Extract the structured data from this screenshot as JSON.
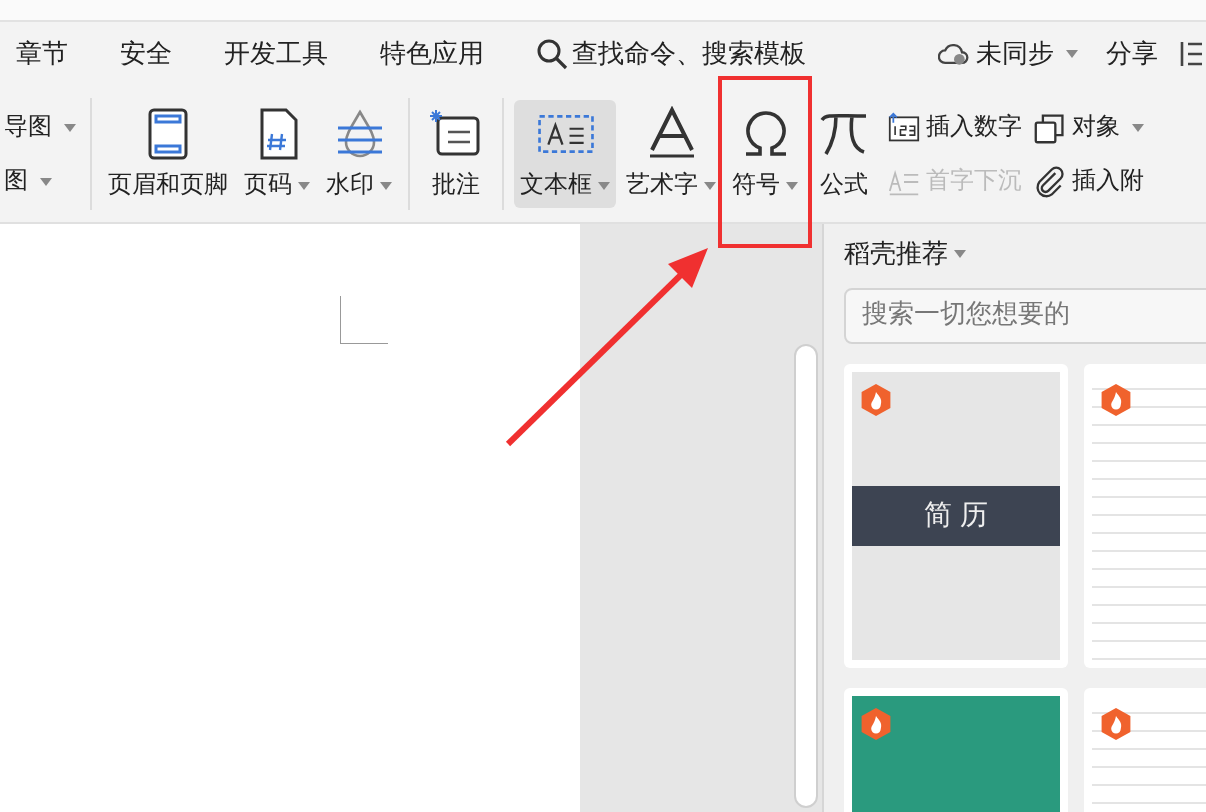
{
  "menu_tabs": [
    {
      "label": "章节"
    },
    {
      "label": "安全"
    },
    {
      "label": "开发工具"
    },
    {
      "label": "特色应用"
    }
  ],
  "search": {
    "placeholder": "查找命令、搜索模板"
  },
  "sync": {
    "label": "未同步",
    "dropdown": true
  },
  "share": {
    "label": "分享"
  },
  "ribbon_groups": [
    {
      "items": [
        {
          "kind": "small",
          "label": "导图",
          "dropdown": true,
          "selected": false,
          "disabled": false
        },
        {
          "kind": "small",
          "label": "图",
          "dropdown": true,
          "selected": false,
          "disabled": false
        }
      ]
    },
    {
      "items": [
        {
          "kind": "large",
          "label": "页眉和页脚",
          "dropdown": false,
          "selected": false,
          "disabled": false
        },
        {
          "kind": "large",
          "label": "页码",
          "dropdown": true,
          "selected": false,
          "disabled": false
        },
        {
          "kind": "large",
          "label": "水印",
          "dropdown": true,
          "selected": false,
          "disabled": false
        }
      ]
    },
    {
      "items": [
        {
          "kind": "large",
          "label": "批注",
          "dropdown": false,
          "selected": false,
          "disabled": false
        }
      ]
    },
    {
      "items": [
        {
          "kind": "large",
          "label": "文本框",
          "dropdown": true,
          "selected": true,
          "disabled": false
        },
        {
          "kind": "large",
          "label": "艺术字",
          "dropdown": true,
          "selected": false,
          "disabled": false
        },
        {
          "kind": "large",
          "label": "符号",
          "dropdown": true,
          "selected": false,
          "disabled": false
        },
        {
          "kind": "large",
          "label": "公式",
          "dropdown": false,
          "selected": false,
          "disabled": false
        },
        {
          "kind": "small",
          "label": "插入数字",
          "dropdown": false,
          "selected": false,
          "disabled": false
        },
        {
          "kind": "small",
          "label": "首字下沉",
          "dropdown": false,
          "selected": false,
          "disabled": true
        },
        {
          "kind": "small",
          "label": "对象",
          "dropdown": true,
          "selected": false,
          "disabled": false
        },
        {
          "kind": "small",
          "label": "插入附",
          "dropdown": false,
          "selected": false,
          "disabled": false
        }
      ]
    }
  ],
  "panel": {
    "title": "稻壳推荐",
    "search": {
      "placeholder": "搜索一切您想要的"
    },
    "cover_title": "简 历"
  }
}
